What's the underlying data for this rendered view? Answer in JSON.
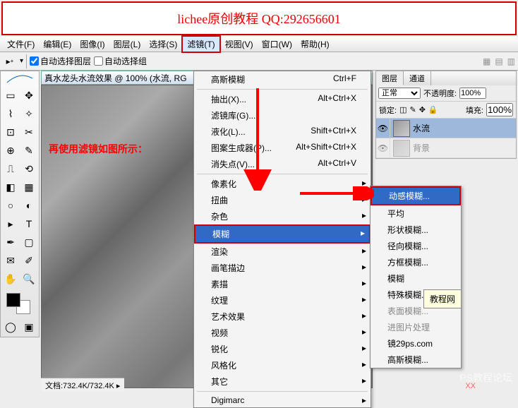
{
  "header": {
    "text": "lichee原创教程 QQ:292656601"
  },
  "menubar": {
    "items": [
      "文件(F)",
      "编辑(E)",
      "图像(I)",
      "图层(L)",
      "选择(S)",
      "滤镜(T)",
      "视图(V)",
      "窗口(W)",
      "帮助(H)"
    ],
    "active_index": 5
  },
  "toolbar": {
    "auto_select_layer": "自动选择图层",
    "auto_select_group": "自动选择组"
  },
  "doc": {
    "title": "真水龙头水流效果 @ 100% (水流, RG",
    "overlay_text": "再使用滤镜如图所示：",
    "status": "文档:732.4K/732.4K"
  },
  "filter_menu": {
    "items": [
      {
        "label": "高斯模糊",
        "shortcut": "Ctrl+F"
      },
      {
        "sep": true
      },
      {
        "label": "抽出(X)...",
        "shortcut": "Alt+Ctrl+X"
      },
      {
        "label": "滤镜库(G)..."
      },
      {
        "label": "液化(L)...",
        "shortcut": "Shift+Ctrl+X"
      },
      {
        "label": "图案生成器(P)...",
        "shortcut": "Alt+Shift+Ctrl+X"
      },
      {
        "label": "消失点(V)...",
        "shortcut": "Alt+Ctrl+V"
      },
      {
        "sep": true
      },
      {
        "label": "像素化",
        "sub": true
      },
      {
        "label": "扭曲",
        "sub": true
      },
      {
        "label": "杂色",
        "sub": true
      },
      {
        "label": "模糊",
        "sub": true,
        "highlight": true
      },
      {
        "label": "渲染",
        "sub": true
      },
      {
        "label": "画笔描边",
        "sub": true
      },
      {
        "label": "素描",
        "sub": true
      },
      {
        "label": "纹理",
        "sub": true
      },
      {
        "label": "艺术效果",
        "sub": true
      },
      {
        "label": "视频",
        "sub": true
      },
      {
        "label": "锐化",
        "sub": true
      },
      {
        "label": "风格化",
        "sub": true
      },
      {
        "label": "其它",
        "sub": true
      },
      {
        "sep": true
      },
      {
        "label": "Digimarc",
        "sub": true
      }
    ]
  },
  "blur_submenu": {
    "items": [
      {
        "label": "动感模糊...",
        "highlight": true
      },
      {
        "label": "平均"
      },
      {
        "label": "形状模糊..."
      },
      {
        "label": "径向模糊..."
      },
      {
        "label": "方框模糊..."
      },
      {
        "label": "模糊"
      },
      {
        "label": "特殊模糊..."
      },
      {
        "label": "表面模糊...",
        "disabled": true
      },
      {
        "label": "进图片处理",
        "disabled": true
      },
      {
        "label": "镜29ps.com"
      },
      {
        "label": "高斯模糊..."
      }
    ]
  },
  "layers_panel": {
    "tabs": [
      "图层",
      "通道"
    ],
    "blend_mode": "正常",
    "opacity_label": "不透明度:",
    "opacity_value": "100%",
    "lock_label": "锁定:",
    "fill_label": "填充:",
    "fill_value": "100%",
    "layers": [
      {
        "name": "水流",
        "visible": true,
        "active": true
      },
      {
        "name": "背景",
        "visible": true,
        "active": false
      }
    ]
  },
  "tooltip": {
    "line1": "教程网",
    "line2": ""
  },
  "watermark": "PS教程论坛",
  "watermark2": "XX"
}
